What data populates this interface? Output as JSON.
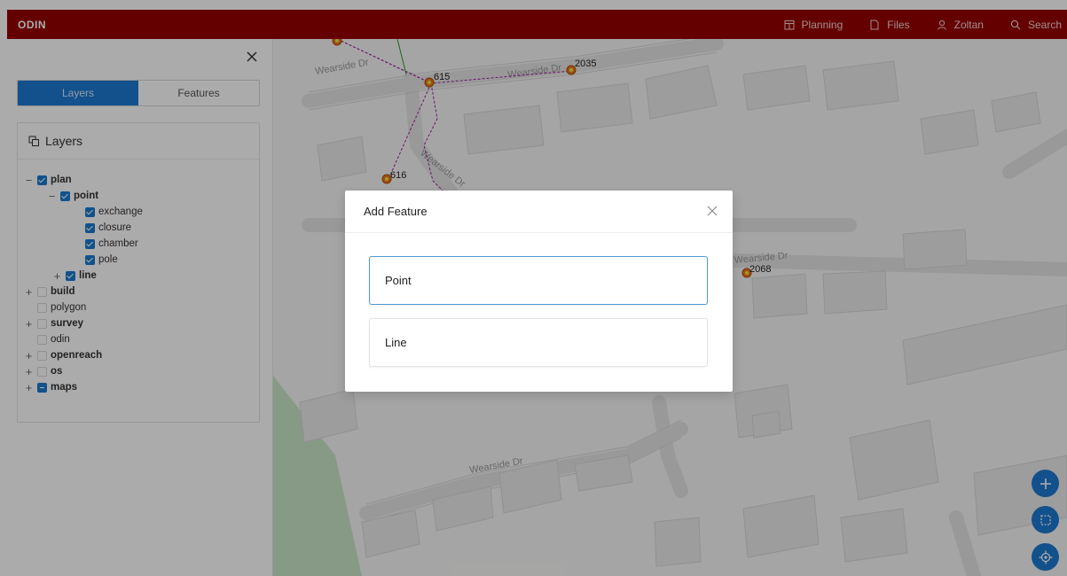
{
  "app": {
    "title": "ODIN"
  },
  "nav": {
    "planning": "Planning",
    "files": "Files",
    "user": "Zoltan",
    "search": "Search"
  },
  "sidebar": {
    "tabs": {
      "layers": "Layers",
      "features": "Features",
      "active": "Layers"
    },
    "card_title": "Layers",
    "tree": [
      {
        "label": "plan",
        "toggle": "−",
        "checked": "checked",
        "bold": true,
        "level": 0
      },
      {
        "label": "point",
        "toggle": "−",
        "checked": "checked",
        "bold": true,
        "level": 1
      },
      {
        "label": "exchange",
        "toggle": "",
        "checked": "checked",
        "bold": false,
        "level": 2
      },
      {
        "label": "closure",
        "toggle": "",
        "checked": "checked",
        "bold": false,
        "level": 2
      },
      {
        "label": "chamber",
        "toggle": "",
        "checked": "checked",
        "bold": false,
        "level": 2
      },
      {
        "label": "pole",
        "toggle": "",
        "checked": "checked",
        "bold": false,
        "level": 2
      },
      {
        "label": "line",
        "toggle": "+",
        "checked": "checked",
        "bold": true,
        "level": 1
      },
      {
        "label": "build",
        "toggle": "+",
        "checked": "unchecked",
        "bold": true,
        "level": 0
      },
      {
        "label": "polygon",
        "toggle": "",
        "checked": "unchecked",
        "bold": false,
        "level": 1
      },
      {
        "label": "survey",
        "toggle": "+",
        "checked": "unchecked",
        "bold": true,
        "level": 0
      },
      {
        "label": "odin",
        "toggle": "",
        "checked": "unchecked",
        "bold": false,
        "level": 1
      },
      {
        "label": "openreach",
        "toggle": "+",
        "checked": "unchecked",
        "bold": true,
        "level": 0
      },
      {
        "label": "os",
        "toggle": "+",
        "checked": "unchecked",
        "bold": true,
        "level": 0
      },
      {
        "label": "maps",
        "toggle": "+",
        "checked": "indeterminate",
        "bold": true,
        "level": 0
      }
    ]
  },
  "map": {
    "street_labels": [
      "Wearside Dr",
      "Wearside Dr",
      "Wearside Dr",
      "Wearside Dr",
      "Wearside Dr"
    ],
    "node_labels": [
      "615",
      "2035",
      "616",
      "2068"
    ]
  },
  "modal": {
    "title": "Add Feature",
    "options": [
      {
        "label": "Point",
        "selected": true
      },
      {
        "label": "Line",
        "selected": false
      }
    ]
  },
  "colors": {
    "topbar": "#960000",
    "accent": "#1b79d1",
    "line": "#a020a0",
    "node": "#e8791e"
  }
}
